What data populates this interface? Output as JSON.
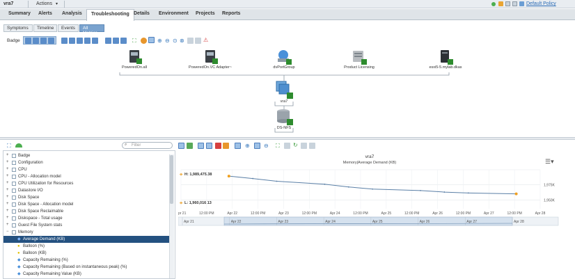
{
  "titlebar": {
    "object_name": "vra7",
    "actions_label": "Actions",
    "policy_label": "Default Policy"
  },
  "tabs": [
    {
      "label": "Summary"
    },
    {
      "label": "Alerts"
    },
    {
      "label": "Analysis"
    },
    {
      "label": "Troubleshooting"
    },
    {
      "label": "Details"
    },
    {
      "label": "Environment"
    },
    {
      "label": "Projects"
    },
    {
      "label": "Reports"
    }
  ],
  "subtabs": [
    {
      "label": "Symptoms"
    },
    {
      "label": "Timeline"
    },
    {
      "label": "Events"
    },
    {
      "label": "All Metrics"
    }
  ],
  "badge_label": "Badge",
  "topology": {
    "nodes": [
      {
        "label": "PoweredOn.all"
      },
      {
        "label": "PoweredOn.VC Adapter~"
      },
      {
        "label": "dvPortGroup"
      },
      {
        "label": "Product Licensing"
      },
      {
        "label": "esxi5-5.mylab.dkas"
      },
      {
        "label": "vra7"
      },
      {
        "label": "DS-NFS"
      }
    ]
  },
  "filter_placeholder": "Filter",
  "tree": {
    "items": [
      {
        "label": "Badge"
      },
      {
        "label": "Configuration"
      },
      {
        "label": "CPU"
      },
      {
        "label": "CPU - Allocation model"
      },
      {
        "label": "CPU Utilization for Resources"
      },
      {
        "label": "Datastore I/O"
      },
      {
        "label": "Disk Space"
      },
      {
        "label": "Disk Space - Allocation model"
      },
      {
        "label": "Disk Space Reclaimable"
      },
      {
        "label": "Diskspace - Total usage"
      },
      {
        "label": "Guest File System stats"
      },
      {
        "label": "Memory"
      },
      {
        "label": "Average Demand (KB)"
      },
      {
        "label": "Balloon (%)"
      },
      {
        "label": "Balloon (KB)"
      },
      {
        "label": "Capacity Remaining (%)"
      },
      {
        "label": "Capacity Remaining (Based on instantaneous peak) (%)"
      },
      {
        "label": "Capacity Remaining Value (KB)"
      }
    ]
  },
  "chart": {
    "title": "vra7",
    "subtitle": "Memory|Average Demand (KB)",
    "high_label": "H: 1,989,475.38",
    "low_label": "L: 1,960,016.13"
  },
  "chart_data": {
    "type": "line",
    "series": [
      {
        "values": [
          1989475.38,
          1985500,
          1981000,
          1976000,
          1971500,
          1968000,
          1965500,
          1963000,
          1961500,
          1960016.13
        ]
      }
    ],
    "x": [
      "2016-04-22",
      "2016-04-22 12:00",
      "2016-04-23",
      "2016-04-24",
      "2016-04-24 12:00",
      "2016-04-25",
      "2016-04-26",
      "2016-04-26 12:00",
      "2016-04-27",
      "2016-04-28"
    ],
    "xticks": [
      "Apr 21",
      "12:00 PM",
      "Apr 22",
      "12:00 PM",
      "Apr 23",
      "12:00 PM",
      "Apr 24",
      "12:00 PM",
      "Apr 25",
      "12:00 PM",
      "Apr 26",
      "12:00 PM",
      "Apr 27",
      "12:00 PM",
      "Apr 28"
    ],
    "navticks": [
      "Apr 21",
      "Apr 22",
      "Apr 23",
      "Apr 24",
      "Apr 25",
      "Apr 26",
      "Apr 27",
      "Apr 28"
    ],
    "yticks": [
      "1,975K",
      "1,950K"
    ],
    "ylim": [
      1940000,
      2000000
    ],
    "colors": {
      "line": "#5a7fa6",
      "marker": "#f0a020"
    }
  }
}
